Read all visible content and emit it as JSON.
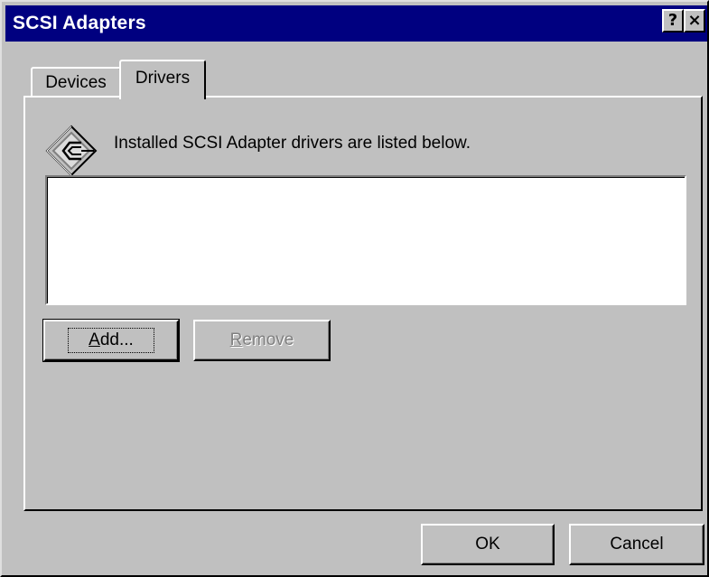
{
  "window": {
    "title": "SCSI Adapters",
    "help_label": "?",
    "close_label": "×"
  },
  "tabs": [
    {
      "label": "Devices",
      "selected": false
    },
    {
      "label": "Drivers",
      "selected": true
    }
  ],
  "drivers_panel": {
    "icon": "scsi-connector-icon",
    "description": "Installed SCSI Adapter drivers are listed below.",
    "drivers_list": [],
    "add_label_mnemonic": "A",
    "add_label_rest": "dd...",
    "remove_label_mnemonic": "R",
    "remove_label_rest": "emove"
  },
  "footer": {
    "ok_label": "OK",
    "cancel_label": "Cancel"
  },
  "colors": {
    "titlebar": "#000080",
    "face": "#c0c0c0",
    "disabled_text": "#808080"
  }
}
